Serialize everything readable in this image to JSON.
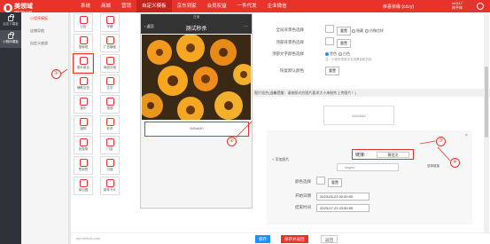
{
  "topbar": {
    "logo_text": "美领域",
    "logo_sub": "MEILING.COM",
    "nav": [
      "系统",
      "商城",
      "营销",
      "自定义模板",
      "京东到家",
      "会员权益",
      "一件代发",
      "企业微信"
    ],
    "active_nav": 3,
    "user": "恭喜依缘 (cdzy)",
    "uid_line1": "m0117",
    "uid_line2": "体平体"
  },
  "sidebar": {
    "items": [
      "自定义模板",
      "小程序模板"
    ],
    "active_index": 1
  },
  "submenu": {
    "items": [
      "小程序模板",
      "店铺导航",
      "自定义底部"
    ],
    "active_index": 0
  },
  "components": [
    {
      "label": "公告",
      "icon": "bell-icon"
    },
    {
      "label": "专题",
      "icon": "tag-icon"
    },
    {
      "label": "搜索框",
      "icon": "search-icon"
    },
    {
      "label": "广告横板",
      "icon": "banner-icon"
    },
    {
      "label": "图片组合",
      "icon": "image-icon",
      "highlight": true
    },
    {
      "label": "商品分组",
      "icon": "box-icon"
    },
    {
      "label": "辅助空白",
      "icon": "blank-icon"
    },
    {
      "label": "文字",
      "icon": "text-icon"
    },
    {
      "label": "音乐",
      "icon": "music-icon"
    },
    {
      "label": "视频",
      "icon": "video-icon"
    },
    {
      "label": "团购",
      "icon": "group-icon"
    },
    {
      "label": "秒杀",
      "icon": "flash-icon"
    },
    {
      "label": "优惠券",
      "icon": "coupon-icon"
    },
    {
      "label": "门店",
      "icon": "store-icon"
    },
    {
      "label": "签到签",
      "icon": "sign-icon"
    },
    {
      "label": "付费",
      "icon": "pay-icon"
    },
    {
      "label": "拿出国",
      "icon": "exit-icon"
    },
    {
      "label": "新年卡片",
      "icon": "card-icon"
    }
  ],
  "phone": {
    "status": "白道",
    "back": "返回",
    "title": "测试秒杀",
    "image_placeholder": "640x640"
  },
  "form": {
    "bg_label": "全局背景色选择",
    "bg_reset": "重置",
    "bg_radio_1": "隐藏",
    "bg_radio_2": "仿微信样",
    "top_bg_label": "顶部背景色选择",
    "top_bg_reset": "重置",
    "text_color_label": "顶部文字颜色选择",
    "text_radio_1": "黑色",
    "text_radio_2": "白色",
    "text_hint": "注：小程序顶部仅支持黑色和白色",
    "restore_label": "恢复默认颜色",
    "restore_btn": "重置",
    "note": "图片组合(温馨提醒：请按照对应图片要求大小来制作上传图片！)",
    "preview_text": "640x640",
    "add_image": "+ 添加图片",
    "jump_label": "链接:",
    "jump_value": "微信文",
    "link_value": "/pages/",
    "set_link": "选择链接",
    "close": "×",
    "color_label": "颜色选择",
    "color_reset": "重置",
    "start_label": "开始日期",
    "start_value": "2023-05-23 00:00:00",
    "end_label": "结束时间",
    "end_value": "2023-07-23 23:59:59"
  },
  "callouts": [
    "①",
    "②",
    "③",
    "④"
  ],
  "bottom": {
    "save": "保存",
    "save_return": "保存并返回",
    "back": "返回"
  },
  "watermark": "erp.meiniu.com",
  "colors": {
    "brand": "#e8322c",
    "sidebar": "#2f3238",
    "save_btn": "#1e90ff"
  }
}
